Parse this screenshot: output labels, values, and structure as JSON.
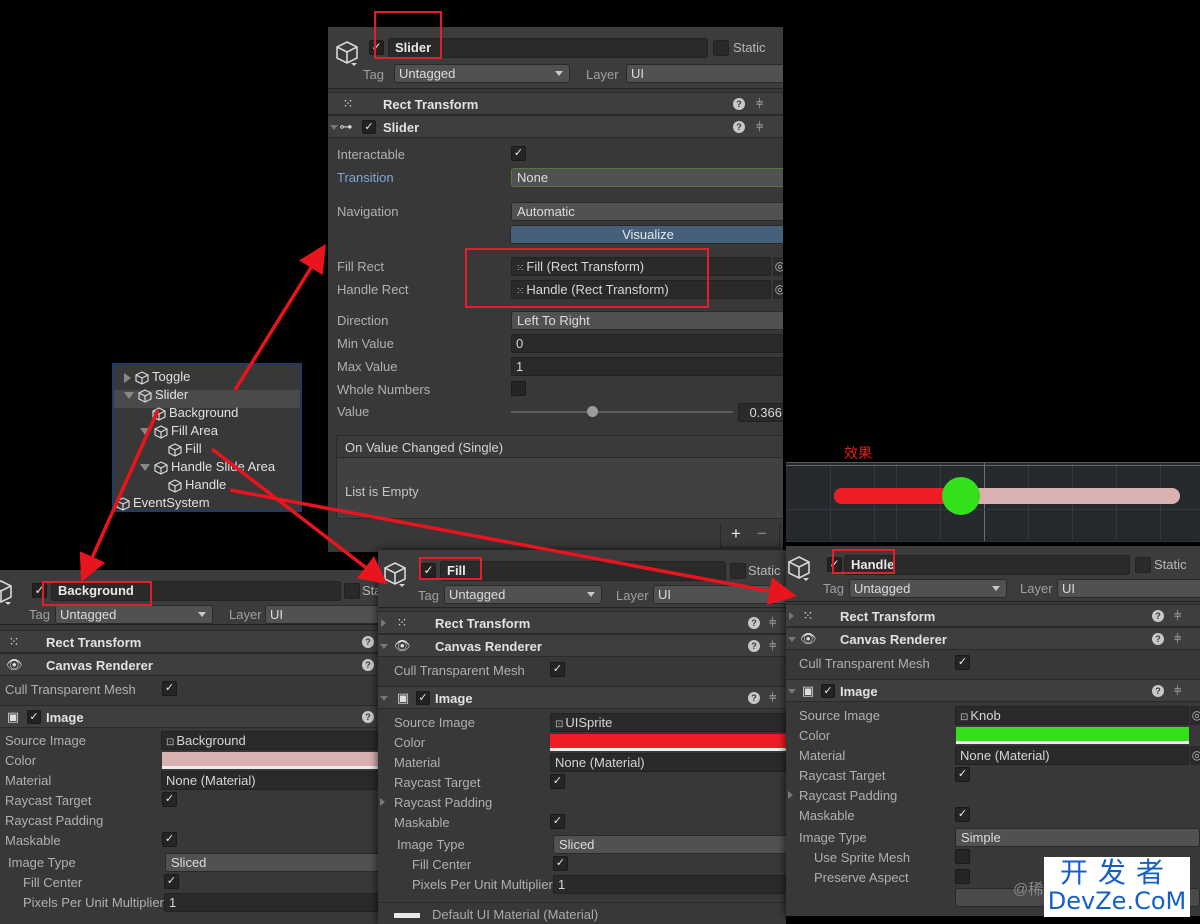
{
  "main_inspector": {
    "object_name": "Slider",
    "active": true,
    "static_label": "Static",
    "tag_label": "Tag",
    "tag_value": "Untagged",
    "layer_label": "Layer",
    "layer_value": "UI",
    "components": {
      "rect_transform": "Rect Transform",
      "slider": "Slider"
    },
    "properties": {
      "interactable": {
        "label": "Interactable",
        "checked": true
      },
      "transition": {
        "label": "Transition",
        "value": "None"
      },
      "navigation": {
        "label": "Navigation",
        "value": "Automatic"
      },
      "visualize_button": "Visualize",
      "fill_rect": {
        "label": "Fill Rect",
        "value": "Fill (Rect Transform)"
      },
      "handle_rect": {
        "label": "Handle Rect",
        "value": "Handle (Rect Transform)"
      },
      "direction": {
        "label": "Direction",
        "value": "Left To Right"
      },
      "min_value": {
        "label": "Min Value",
        "value": "0"
      },
      "max_value": {
        "label": "Max Value",
        "value": "1"
      },
      "whole_numbers": {
        "label": "Whole Numbers",
        "checked": false
      },
      "value": {
        "label": "Value",
        "value": "0.366",
        "fraction": 0.366
      }
    },
    "event": {
      "title": "On Value Changed (Single)",
      "empty_text": "List is Empty",
      "add": "+",
      "remove": "−"
    }
  },
  "hierarchy": {
    "items": [
      {
        "label": "Toggle",
        "expander": "closed"
      },
      {
        "label": "Slider",
        "expander": "open",
        "selected": true
      },
      {
        "label": "Background",
        "expander": "none"
      },
      {
        "label": "Fill Area",
        "expander": "open"
      },
      {
        "label": "Fill",
        "expander": "none"
      },
      {
        "label": "Handle Slide Area",
        "expander": "open"
      },
      {
        "label": "Handle",
        "expander": "none"
      },
      {
        "label": "EventSystem",
        "expander": "none"
      }
    ]
  },
  "effect_preview": {
    "label": "效果",
    "slider_fraction": 0.366,
    "fill_color": "#ee1c24",
    "background_color": "#d9b1b1",
    "handle_color": "#33e019"
  },
  "background_inspector": {
    "object_name": "Background",
    "static_label": "Sta",
    "tag_label": "Tag",
    "tag_value": "Untagged",
    "layer_label": "Layer",
    "layer_value": "UI",
    "components": {
      "rect_transform": "Rect Transform",
      "canvas_renderer": "Canvas Renderer",
      "image": "Image"
    },
    "cull_transparent_mesh": "Cull Transparent Mesh",
    "source_image": {
      "label": "Source Image",
      "value": "Background"
    },
    "color": {
      "label": "Color",
      "hex": "#d9b1b1"
    },
    "material": {
      "label": "Material",
      "value": "None (Material)"
    },
    "raycast_target": "Raycast Target",
    "raycast_padding": "Raycast Padding",
    "maskable": "Maskable",
    "image_type": {
      "label": "Image Type",
      "value": "Sliced"
    },
    "fill_center": "Fill Center",
    "ppu": {
      "label": "Pixels Per Unit Multiplier",
      "value": "1"
    }
  },
  "fill_inspector": {
    "object_name": "Fill",
    "static_label": "Static",
    "tag_label": "Tag",
    "tag_value": "Untagged",
    "layer_label": "Layer",
    "layer_value": "UI",
    "components": {
      "rect_transform": "Rect Transform",
      "canvas_renderer": "Canvas Renderer",
      "image": "Image"
    },
    "cull_transparent_mesh": "Cull Transparent Mesh",
    "source_image": {
      "label": "Source Image",
      "value": "UISprite"
    },
    "color": {
      "label": "Color",
      "hex": "#ee1c24"
    },
    "material": {
      "label": "Material",
      "value": "None (Material)"
    },
    "raycast_target": "Raycast Target",
    "raycast_padding": "Raycast Padding",
    "maskable": "Maskable",
    "image_type": {
      "label": "Image Type",
      "value": "Sliced"
    },
    "fill_center": "Fill Center",
    "ppu": {
      "label": "Pixels Per Unit Multiplier",
      "value": "1"
    },
    "material_footer": "Default UI Material (Material)"
  },
  "handle_inspector": {
    "object_name": "Handle",
    "static_label": "Static",
    "tag_label": "Tag",
    "tag_value": "Untagged",
    "layer_label": "Layer",
    "layer_value": "UI",
    "components": {
      "rect_transform": "Rect Transform",
      "canvas_renderer": "Canvas Renderer",
      "image": "Image"
    },
    "cull_transparent_mesh": "Cull Transparent Mesh",
    "source_image": {
      "label": "Source Image",
      "value": "Knob"
    },
    "color": {
      "label": "Color",
      "hex": "#33e019"
    },
    "material": {
      "label": "Material",
      "value": "None (Material)"
    },
    "raycast_target": "Raycast Target",
    "raycast_padding": "Raycast Padding",
    "maskable": "Maskable",
    "image_type": {
      "label": "Image Type",
      "value": "Simple"
    },
    "use_sprite_mesh": "Use Sprite Mesh",
    "preserve_aspect": "Preserve Aspect"
  },
  "watermark": {
    "line1": "开发者",
    "line2": "DevZe.CoM",
    "at_text": "@稀"
  }
}
